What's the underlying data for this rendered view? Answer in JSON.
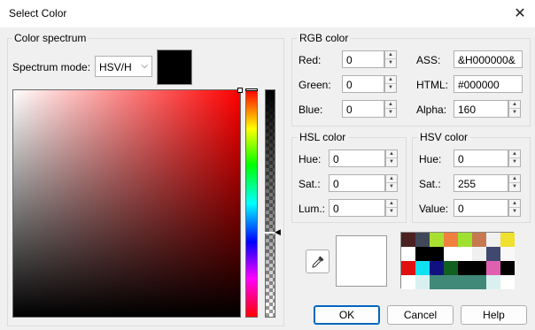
{
  "window": {
    "title": "Select Color",
    "close_glyph": "✕"
  },
  "spectrum": {
    "group_label": "Color spectrum",
    "mode_label": "Spectrum mode:",
    "mode_value": "HSV/H",
    "preview_color": "#000000"
  },
  "rgb": {
    "group_label": "RGB color",
    "red": {
      "label": "Red:",
      "value": "0"
    },
    "green": {
      "label": "Green:",
      "value": "0"
    },
    "blue": {
      "label": "Blue:",
      "value": "0"
    },
    "ass": {
      "label": "ASS:",
      "value": "&H000000&"
    },
    "html": {
      "label": "HTML:",
      "value": "#000000"
    },
    "alpha": {
      "label": "Alpha:",
      "value": "160"
    }
  },
  "hsl": {
    "group_label": "HSL color",
    "hue": {
      "label": "Hue:",
      "value": "0"
    },
    "sat": {
      "label": "Sat.:",
      "value": "0"
    },
    "lum": {
      "label": "Lum.:",
      "value": "0"
    }
  },
  "hsv": {
    "group_label": "HSV color",
    "hue": {
      "label": "Hue:",
      "value": "0"
    },
    "sat": {
      "label": "Sat.:",
      "value": "255"
    },
    "value": {
      "label": "Value:",
      "value": "0"
    }
  },
  "recent_colors": {
    "row1": [
      "#4a2020",
      "#404858",
      "#a8e030",
      "#f08040",
      "#a0e030",
      "#c87850",
      "#f0f0f0",
      "#f0e030"
    ],
    "row2": [
      "#ffffff",
      "#000000",
      "#000000",
      "#ffffff",
      "#ffffff",
      "#f0f0f0",
      "#404870",
      "#f8f8f8"
    ],
    "row3": [
      "#e01010",
      "#10e0f0",
      "#101080",
      "#106020",
      "#000000",
      "#000000",
      "#e060b0",
      "#000000"
    ],
    "row4": [
      "#ffffff",
      "#d8f0f0",
      "#408878",
      "#408878",
      "#408878",
      "#408878",
      "#d8f0f0",
      "#ffffff"
    ]
  },
  "buttons": {
    "ok": "OK",
    "cancel": "Cancel",
    "help": "Help"
  }
}
